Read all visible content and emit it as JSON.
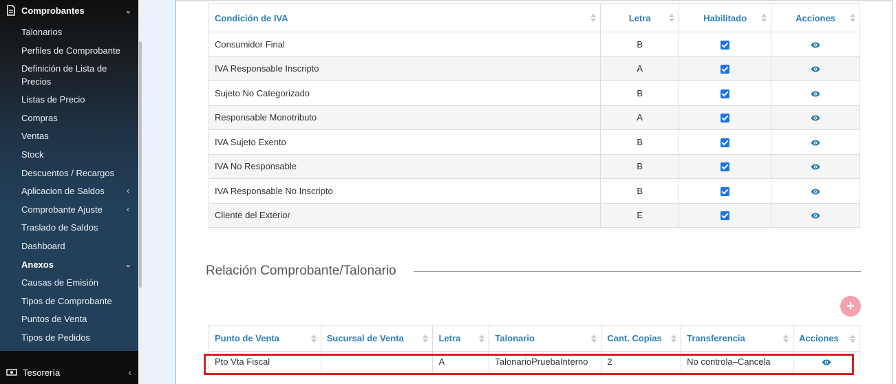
{
  "sidebar": {
    "sections": [
      {
        "label": "Comprobantes",
        "icon": "document-icon"
      },
      {
        "label": "Anexos"
      },
      {
        "label": "Tesorería",
        "icon": "money-icon"
      }
    ],
    "comprobantes_items": [
      {
        "label": "Talonarios"
      },
      {
        "label": "Perfiles de Comprobante"
      },
      {
        "label": "Definición de Lista de Precios"
      },
      {
        "label": "Listas de Precio"
      },
      {
        "label": "Compras"
      },
      {
        "label": "Ventas"
      },
      {
        "label": "Stock"
      },
      {
        "label": "Descuentos / Recargos"
      },
      {
        "label": "Aplicacion de Saldos",
        "arrow": "‹"
      },
      {
        "label": "Comprobante Ajuste",
        "arrow": "‹"
      },
      {
        "label": "Traslado de Saldos"
      },
      {
        "label": "Dashboard"
      }
    ],
    "anexos_items": [
      {
        "label": "Causas de Emisión"
      },
      {
        "label": "Tipos de Comprobante"
      },
      {
        "label": "Puntos de Venta"
      },
      {
        "label": "Tipos de Pedidos"
      }
    ]
  },
  "iva_table": {
    "headers": [
      "Condición de IVA",
      "Letra",
      "Habilitado",
      "Acciones"
    ],
    "rows": [
      {
        "condicion": "Consumidor Final",
        "letra": "B",
        "habilitado": true
      },
      {
        "condicion": "IVA Responsable Inscripto",
        "letra": "A",
        "habilitado": true
      },
      {
        "condicion": "Sujeto No Categorizado",
        "letra": "B",
        "habilitado": true
      },
      {
        "condicion": "Responsable Monotributo",
        "letra": "A",
        "habilitado": true
      },
      {
        "condicion": "IVA Sujeto Exento",
        "letra": "B",
        "habilitado": true
      },
      {
        "condicion": "IVA No Responsable",
        "letra": "B",
        "habilitado": true
      },
      {
        "condicion": "IVA Responsable No Inscripto",
        "letra": "B",
        "habilitado": true
      },
      {
        "condicion": "Cliente del Exterior",
        "letra": "E",
        "habilitado": true
      }
    ]
  },
  "relacion": {
    "title": "Relación Comprobante/Talonario",
    "add_label": "+",
    "headers": [
      "Punto de Venta",
      "Sucursal de Venta",
      "Letra",
      "Talonario",
      "Cant. Copias",
      "Transferencia",
      "Acciones"
    ],
    "rows": [
      {
        "punto": "Pto Vta Fiscal",
        "sucursal": "",
        "letra": "A",
        "talonario": "TalonarioPruebaInterno",
        "copias": "2",
        "transferencia": "No controla–Cancela"
      }
    ]
  },
  "colors": {
    "accent": "#2f7fb5",
    "checkbox": "#1a73e8",
    "highlight": "#d0242b",
    "add_button": "#f3a1ad"
  }
}
